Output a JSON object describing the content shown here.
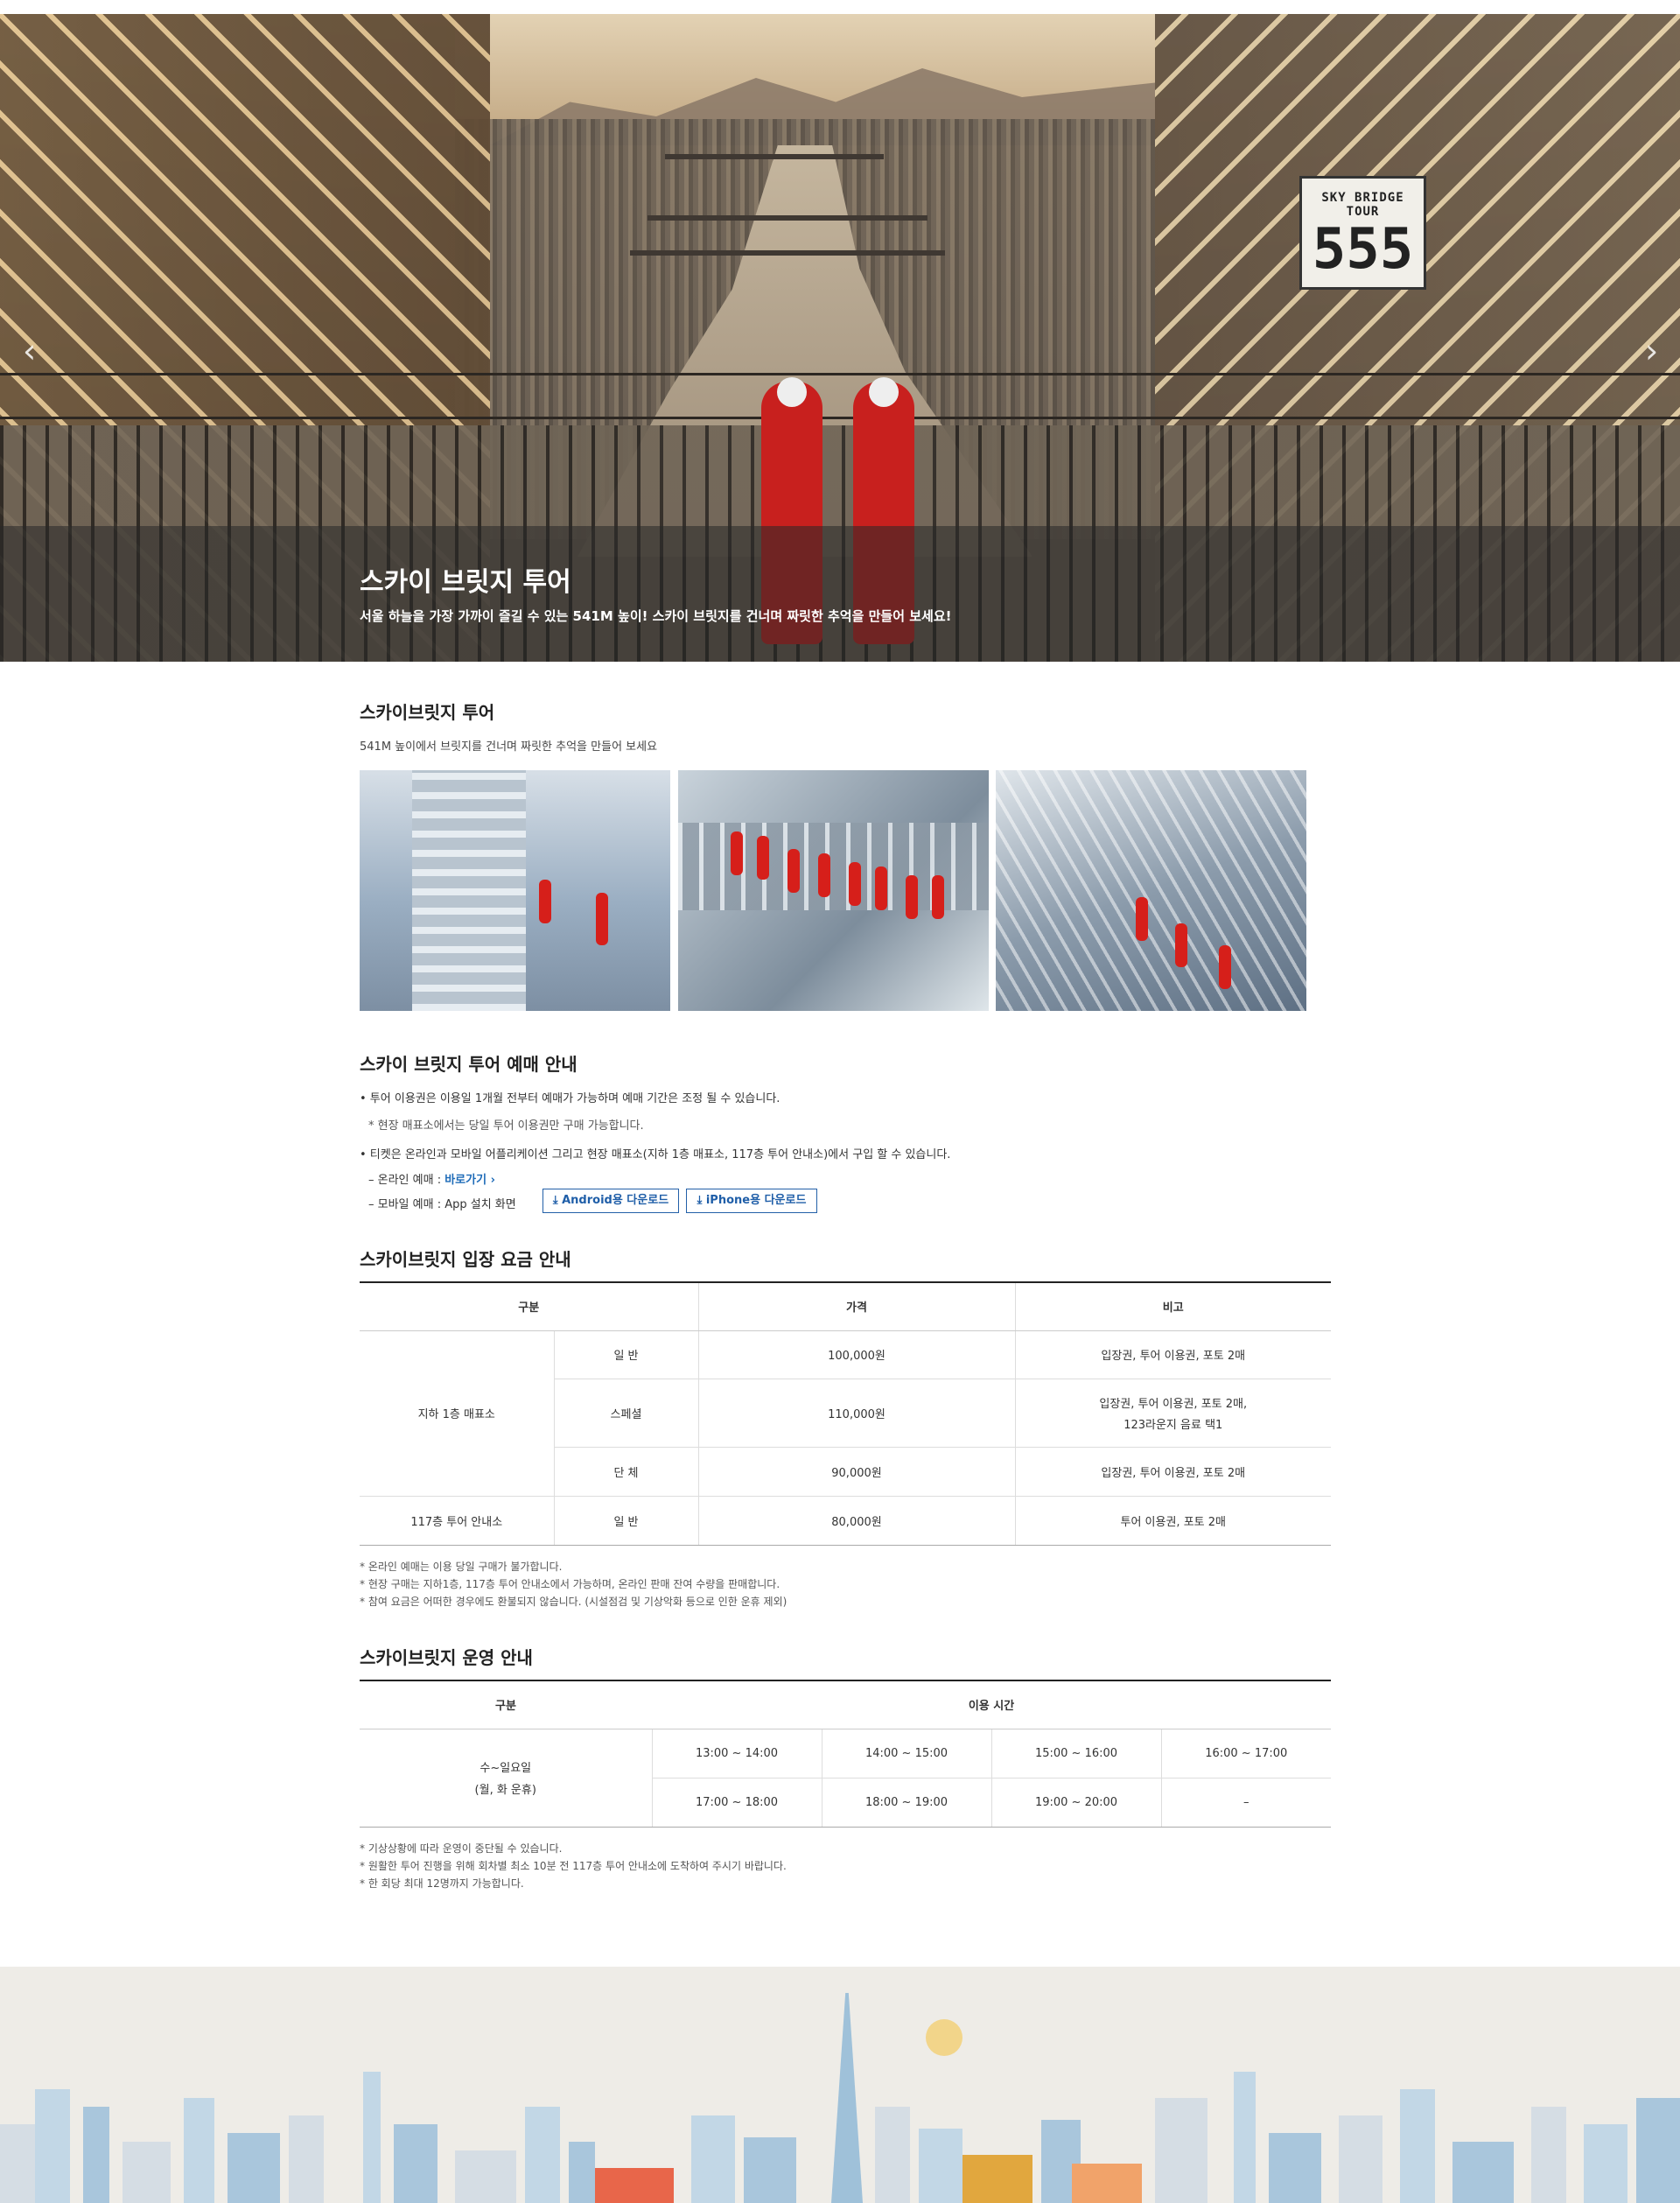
{
  "hero": {
    "title": "스카이 브릿지 투어",
    "subtitle": "서울 하늘을 가장 가까이 즐길 수 있는 541M 높이! 스카이 브릿지를 건너며 짜릿한 추억을 만들어 보세요!",
    "sign_line1": "SKY BRIDGE TOUR",
    "sign_line2": "555",
    "prev_icon": "chevron-left-icon",
    "next_icon": "chevron-right-icon"
  },
  "intro": {
    "title": "스카이브릿지 투어",
    "desc": "541M 높이에서 브릿지를 건너며 짜릿한 추억을 만들어 보세요"
  },
  "booking": {
    "title": "스카이 브릿지 투어 예매 안내",
    "line1": "• 투어 이용권은 이용일 1개월 전부터 예매가 가능하며 예매 기간은 조정 될 수 있습니다.",
    "line2": "* 현장 매표소에서는 당일 투어 이용권만 구매 가능합니다.",
    "line3": "• 티켓은 온라인과 모바일 어플리케이션 그리고 현장 매표소(지하 1층 매표소, 117층 투어 안내소)에서 구입 할 수 있습니다.",
    "online_prefix": "– 온라인 예매 :",
    "online_link": "바로가기 ›",
    "mobile_prefix": "– 모바일 예매 : App 설치 화면",
    "android_btn": "⤓  Android용 다운로드",
    "iphone_btn": "⤓  iPhone용 다운로드"
  },
  "price": {
    "title": "스카이브릿지 입장 요금 안내",
    "headers": [
      "구분",
      "가격",
      "비고"
    ],
    "loc1": "지하 1층 매표소",
    "loc2": "117층 투어 안내소",
    "rows": [
      {
        "type": "일   반",
        "price": "100,000원",
        "note": "입장권, 투어 이용권, 포토 2매"
      },
      {
        "type": "스페셜",
        "price": "110,000원",
        "note1": "입장권, 투어 이용권, 포토 2매,",
        "note2": "123라운지 음료 택1"
      },
      {
        "type": "단   체",
        "price": "90,000원",
        "note": "입장권, 투어 이용권, 포토 2매"
      },
      {
        "type": "일   반",
        "price": "80,000원",
        "note": "투어 이용권, 포토 2매"
      }
    ],
    "notes": [
      "* 온라인 예매는 이용 당일 구매가 불가합니다.",
      "* 현장 구매는 지하1층, 117층 투어 안내소에서 가능하며, 온라인 판매 잔여 수량을 판매합니다.",
      "* 참여 요금은 어떠한 경우에도 환불되지 않습니다. (시설점검 및 기상악화 등으로 인한 운휴 제외)"
    ]
  },
  "operation": {
    "title": "스카이브릿지 운영 안내",
    "headers": [
      "구분",
      "이용 시간"
    ],
    "day1": "수~일요일",
    "day2": "(월, 화 운휴)",
    "row1": [
      "13:00 ~ 14:00",
      "14:00 ~ 15:00",
      "15:00 ~ 16:00",
      "16:00 ~ 17:00"
    ],
    "row2": [
      "17:00 ~ 18:00",
      "18:00 ~ 19:00",
      "19:00 ~ 20:00",
      "–"
    ],
    "notes": [
      "* 기상상황에 따라 운영이 중단될 수 있습니다.",
      "* 원활한 투어 진행을 위해 회차별 최소 10분 전 117층 투어 안내소에 도착하여 주시기 바랍니다.",
      "* 한 회당 최대 12명까지 가능합니다."
    ]
  },
  "colors": {
    "accent": "#1e6bb8",
    "hero_overlay": "#282828",
    "skyline": "#c2d7e6"
  }
}
